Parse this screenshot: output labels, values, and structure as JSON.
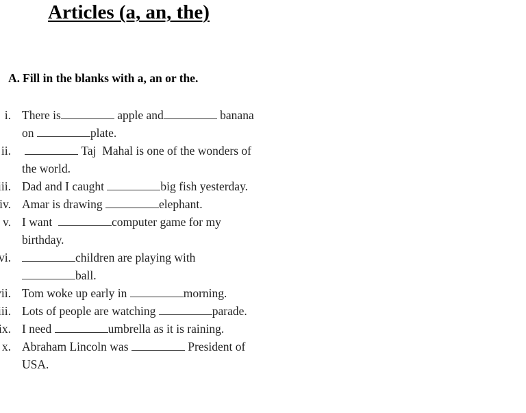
{
  "document": {
    "title": "Articles (a, an, the)",
    "section": {
      "letter": "A.",
      "instruction": "Fill in the blanks with a, an or the."
    },
    "blank_placeholder": "________",
    "items": [
      {
        "num": "i.",
        "lines": [
          "There is{B} apple and{B} banana",
          "on {B}plate."
        ]
      },
      {
        "num": "ii.",
        "lines": [
          " {B} Taj  Mahal is one of the wonders of",
          "the world."
        ]
      },
      {
        "num": "iii.",
        "lines": [
          "Dad and I caught {B}big fish yesterday."
        ]
      },
      {
        "num": "iv.",
        "lines": [
          "Amar is drawing {B}elephant."
        ]
      },
      {
        "num": "v.",
        "lines": [
          "I want  {B}computer game for my",
          "birthday."
        ]
      },
      {
        "num": "vi.",
        "lines": [
          "{B}children are playing with",
          "{B}ball."
        ]
      },
      {
        "num": "vii.",
        "lines": [
          "Tom woke up early in {B}morning."
        ]
      },
      {
        "num": "viii.",
        "lines": [
          "Lots of people are watching {B}parade."
        ]
      },
      {
        "num": "ix.",
        "lines": [
          "I need {B}umbrella as it is raining."
        ]
      },
      {
        "num": "x.",
        "lines": [
          "Abraham Lincoln was {B} President of",
          "USA."
        ]
      }
    ]
  }
}
